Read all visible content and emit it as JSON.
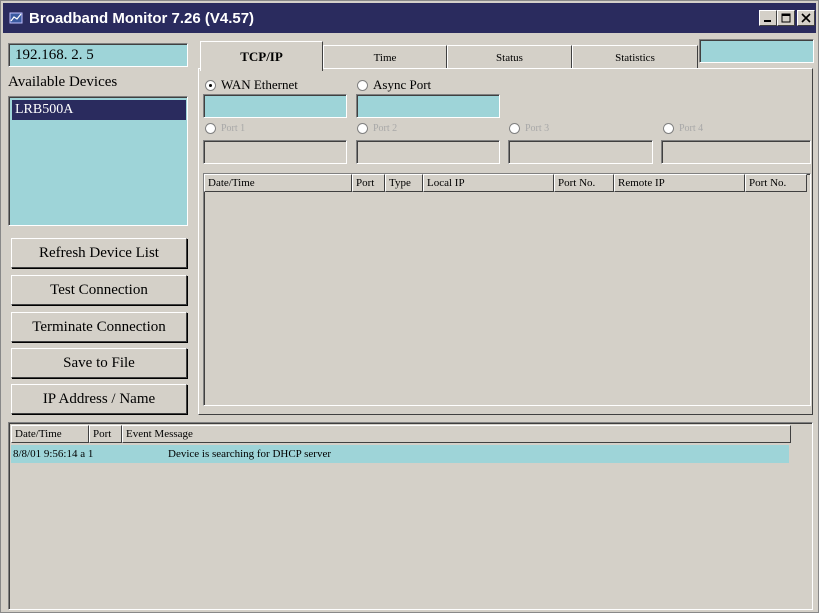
{
  "window": {
    "title": "Broadband Monitor 7.26  (V4.57)"
  },
  "left": {
    "ip_value": "192.168. 2. 5",
    "available_devices_label": "Available Devices",
    "devices": [
      "LRB500A"
    ],
    "buttons": {
      "refresh": "Refresh Device List",
      "test": "Test Connection",
      "terminate": "Terminate Connection",
      "save": "Save to File",
      "ip_name": "IP Address / Name"
    }
  },
  "tabs": [
    "TCP/IP",
    "Time",
    "Status",
    "Statistics"
  ],
  "active_tab": "TCP/IP",
  "tcpip": {
    "radio_wan": "WAN Ethernet",
    "radio_async": "Async Port",
    "radio_disabled": [
      "Port 1",
      "Port 2",
      "Port 3",
      "Port 4"
    ],
    "columns": [
      "Date/Time",
      "Port",
      "Type",
      "Local IP",
      "Port No.",
      "Remote IP",
      "Port No."
    ]
  },
  "events": {
    "columns": [
      "Date/Time",
      "Port",
      "Event Message"
    ],
    "rows": [
      {
        "datetime": "8/8/01 9:56:14 a 1",
        "port": "",
        "message": "Device is searching for DHCP server"
      }
    ]
  },
  "colors": {
    "titlebar": "#2a2b5e",
    "field_cyan": "#9ed4d8",
    "face": "#d4d0c8"
  }
}
